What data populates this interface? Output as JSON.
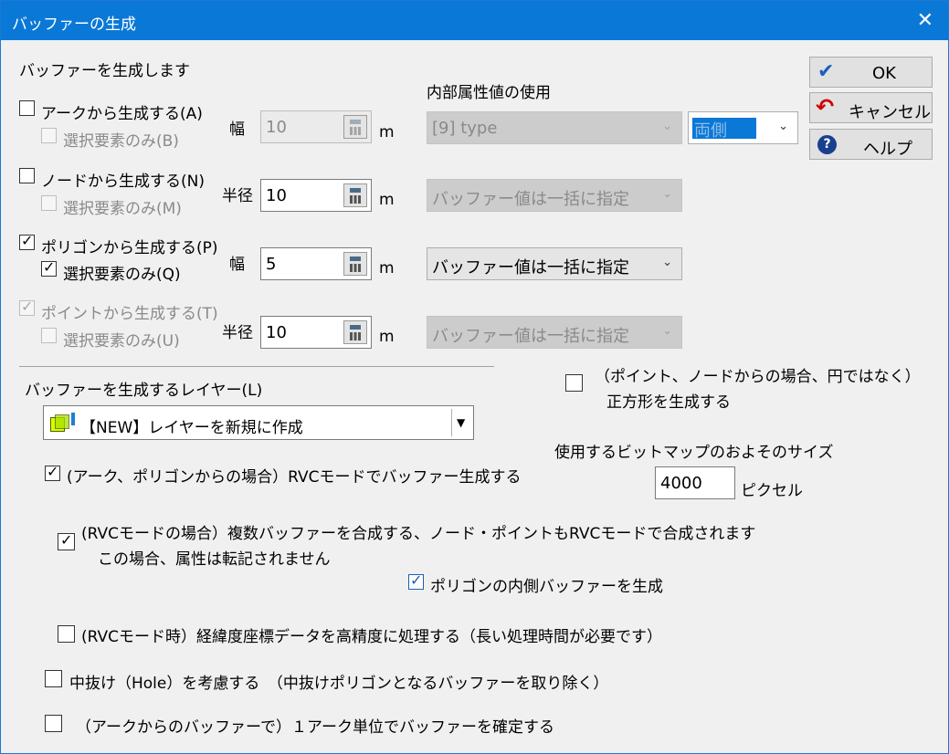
{
  "window": {
    "title": "バッファーの生成",
    "close_glyph": "✕"
  },
  "heading": "バッファーを生成します",
  "attr_heading": "内部属性値の使用",
  "sources": {
    "arc": {
      "label": "アークから生成する(A)",
      "checked": false,
      "sub_label": "選択要素のみ(B)",
      "sub_checked": false,
      "param_label": "幅",
      "value": "10",
      "unit": "m",
      "attr": "[9] type",
      "side": "両側"
    },
    "node": {
      "label": "ノードから生成する(N)",
      "checked": false,
      "sub_label": "選択要素のみ(M)",
      "sub_checked": false,
      "param_label": "半径",
      "value": "10",
      "unit": "m",
      "attr": "バッファー値は一括に指定"
    },
    "polygon": {
      "label": "ポリゴンから生成する(P)",
      "checked": true,
      "sub_label": "選択要素のみ(Q)",
      "sub_checked": true,
      "param_label": "幅",
      "value": "5",
      "unit": "m",
      "attr": "バッファー値は一括に指定"
    },
    "point": {
      "label": "ポイントから生成する(T)",
      "checked": true,
      "sub_label": "選択要素のみ(U)",
      "sub_checked": false,
      "param_label": "半径",
      "value": "10",
      "unit": "m",
      "attr": "バッファー値は一括に指定"
    }
  },
  "buttons": {
    "ok": "OK",
    "cancel": "キャンセル",
    "help": "ヘルプ"
  },
  "square": {
    "line1": "（ポイント、ノードからの場合、円ではなく）",
    "line2": "正方形を生成する",
    "checked": false
  },
  "layer": {
    "label": "バッファーを生成するレイヤー(L)",
    "value": "【NEW】レイヤーを新規に作成"
  },
  "bitmap": {
    "label": "使用するビットマップのおよそのサイズ",
    "value": "4000",
    "unit": "ピクセル"
  },
  "options": {
    "rvc": {
      "label": "(アーク、ポリゴンからの場合）RVCモードでバッファー生成する",
      "checked": true
    },
    "merge": {
      "line1": "(RVCモードの場合）複数バッファーを合成する、ノード・ポイントもRVCモードで合成されます",
      "line2": "この場合、属性は転記されません",
      "checked": true
    },
    "inner": {
      "label": "ポリゴンの内側バッファーを生成",
      "checked": true
    },
    "precise": {
      "label": "(RVCモード時）経緯度座標データを高精度に処理する（長い処理時間が必要です）",
      "checked": false
    },
    "hole": {
      "label": "中抜け（Hole）を考慮する　（中抜けポリゴンとなるバッファーを取り除く）",
      "checked": false
    },
    "unit_arc": {
      "label": "（アークからのバッファーで）１アーク単位でバッファーを確定する",
      "checked": false
    }
  }
}
